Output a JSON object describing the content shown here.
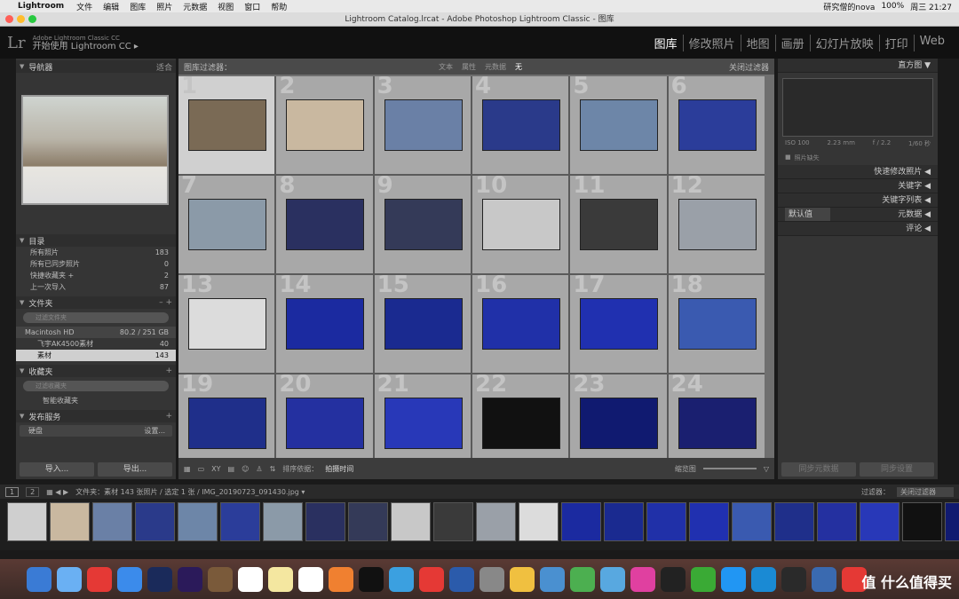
{
  "menubar": {
    "apple": "",
    "app": "Lightroom",
    "items": [
      "文件",
      "编辑",
      "图库",
      "照片",
      "元数据",
      "视图",
      "窗口",
      "帮助"
    ],
    "right": {
      "user": "研究僧的nova",
      "battery": "100%",
      "date": "周三 21:27"
    }
  },
  "window": {
    "title": "Lightroom Catalog.lrcat - Adobe Photoshop Lightroom Classic - 图库"
  },
  "identity": {
    "sub": "Adobe Lightroom Classic CC",
    "main": "开始使用 Lightroom CC ▸",
    "logo": "Lr"
  },
  "modules": [
    "图库",
    "修改照片",
    "地图",
    "画册",
    "幻灯片放映",
    "打印",
    "Web"
  ],
  "left": {
    "navigator": {
      "title": "导航器",
      "zoom": [
        "适合",
        "填满",
        "1:1",
        "3:1"
      ]
    },
    "catalog": {
      "title": "目录",
      "rows": [
        {
          "label": "所有照片",
          "count": "183"
        },
        {
          "label": "所有已同步照片",
          "count": "0"
        },
        {
          "label": "快捷收藏夹 +",
          "count": "2"
        },
        {
          "label": "上一次导入",
          "count": "87"
        }
      ]
    },
    "folders": {
      "title": "文件夹",
      "search": "过滤文件夹",
      "volume": "Macintosh HD",
      "volsize": "80.2 / 251 GB",
      "items": [
        {
          "label": "飞宇AK4500素材",
          "count": "40"
        },
        {
          "label": "素材",
          "count": "143"
        }
      ]
    },
    "collections": {
      "title": "收藏夹",
      "search": "过滤收藏夹",
      "items": [
        "智能收藏夹"
      ]
    },
    "publish": {
      "title": "发布服务",
      "items": [
        {
          "label": "硬盘",
          "action": "设置..."
        }
      ]
    },
    "import": "导入...",
    "export": "导出..."
  },
  "filter": {
    "title": "图库过滤器：",
    "options": [
      "文本",
      "属性",
      "元数据",
      "无"
    ],
    "right": "关闭过滤器"
  },
  "grid": {
    "numbers": [
      "1",
      "2",
      "3",
      "4",
      "5",
      "6",
      "7",
      "8",
      "9",
      "10",
      "11",
      "12",
      "13",
      "14",
      "15",
      "16",
      "17",
      "18",
      "19",
      "20",
      "21",
      "22",
      "23",
      "24"
    ]
  },
  "toolbar": {
    "sort": "排序依据：",
    "sortval": "拍摄时间",
    "thumbs": "缩览图"
  },
  "right": {
    "histogram": "直方图",
    "exif": [
      "ISO 100",
      "2.23 mm",
      "f / 2.2",
      "1/60 秒"
    ],
    "missing": "照片缺失",
    "panels": [
      "快速修改照片",
      "关键字",
      "关键字列表",
      "元数据",
      "评论"
    ],
    "preset": "默认值",
    "sync_meta": "同步元数据",
    "sync_settings": "同步设置"
  },
  "status": {
    "path": "文件夹：素材  143 张照片 / 选定 1 张 / IMG_20190723_091430.jpg ▾",
    "filter": "过滤器：",
    "filterval": "关闭过滤器",
    "pages": [
      "1",
      "2"
    ]
  },
  "watermark": "值 什么值得买"
}
